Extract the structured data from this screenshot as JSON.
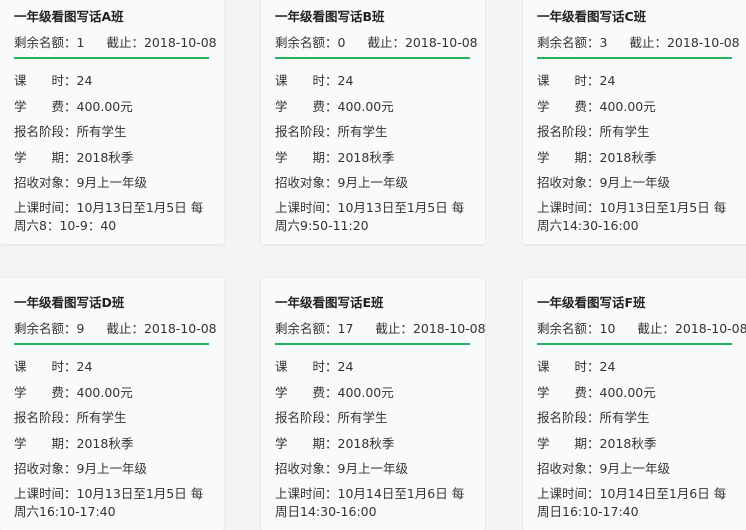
{
  "labels": {
    "remaining": "剩余名额：",
    "deadline": "截止：",
    "hours": "课　　时：",
    "fee": "学　　费：",
    "stage": "报名阶段：",
    "term": "学　　期：",
    "target": "招收对象：",
    "schedule": "上课时间："
  },
  "cards": [
    {
      "title": "一年级看图写话A班",
      "remaining": "1",
      "deadline": "2018-10-08",
      "hours": "24",
      "fee": "400.00元",
      "stage": "所有学生",
      "term": "2018秋季",
      "target": "9月上一年级",
      "schedule": "10月13日至1月5日 每周六8：10-9：40"
    },
    {
      "title": "一年级看图写话B班",
      "remaining": "0",
      "deadline": "2018-10-08",
      "hours": "24",
      "fee": "400.00元",
      "stage": "所有学生",
      "term": "2018秋季",
      "target": "9月上一年级",
      "schedule": "10月13日至1月5日 每周六9:50-11:20"
    },
    {
      "title": "一年级看图写话C班",
      "remaining": "3",
      "deadline": "2018-10-08",
      "hours": "24",
      "fee": "400.00元",
      "stage": "所有学生",
      "term": "2018秋季",
      "target": "9月上一年级",
      "schedule": "10月13日至1月5日 每周六14:30-16:00"
    },
    {
      "title": "一年级看图写话D班",
      "remaining": "9",
      "deadline": "2018-10-08",
      "hours": "24",
      "fee": "400.00元",
      "stage": "所有学生",
      "term": "2018秋季",
      "target": "9月上一年级",
      "schedule": "10月13日至1月5日 每周六16:10-17:40"
    },
    {
      "title": "一年级看图写话E班",
      "remaining": "17",
      "deadline": "2018-10-08",
      "hours": "24",
      "fee": "400.00元",
      "stage": "所有学生",
      "term": "2018秋季",
      "target": "9月上一年级",
      "schedule": "10月14日至1月6日 每周日14:30-16:00"
    },
    {
      "title": "一年级看图写话F班",
      "remaining": "10",
      "deadline": "2018-10-08",
      "hours": "24",
      "fee": "400.00元",
      "stage": "所有学生",
      "term": "2018秋季",
      "target": "9月上一年级",
      "schedule": "10月14日至1月6日 每周日16:10-17:40"
    }
  ],
  "colors": {
    "accent": "#23b35a",
    "card_bg": "#f8fafb",
    "page_bg": "#f2f4f6"
  }
}
